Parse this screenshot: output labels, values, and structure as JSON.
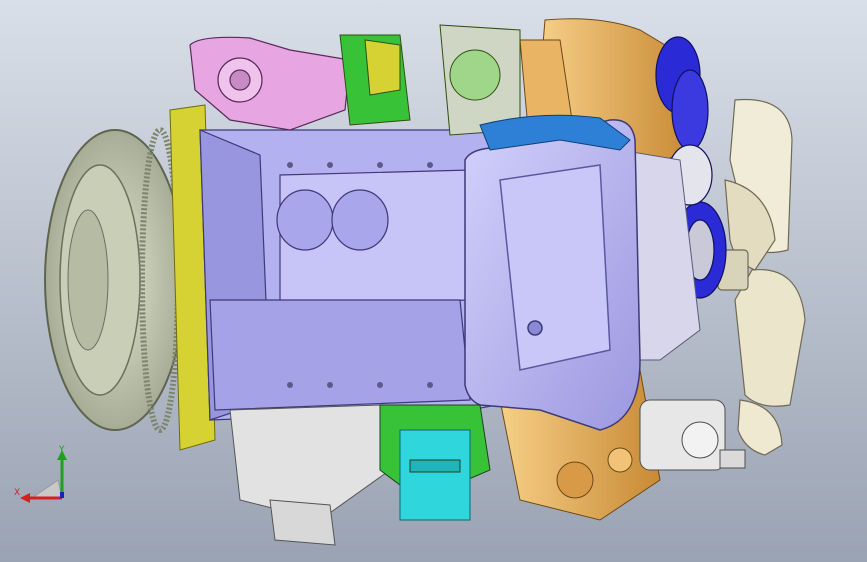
{
  "viewport": {
    "background_top": "#d9dfe8",
    "background_bottom": "#9aa3b3"
  },
  "model": {
    "subject": "engine-assembly-cad-model",
    "colors": {
      "block": "#b4b1f0",
      "block_dark": "#7d79c9",
      "oil_pan": "#c3c0f5",
      "flywheel": "#c9ceb6",
      "flywheel_ring": "#9aa089",
      "fan": "#f1ecd7",
      "alternator": "#e9b463",
      "manifold_pink": "#e7a5e2",
      "cooler_cyan": "#2fd6dc",
      "hose_blue": "#2e7fd6",
      "accent_green": "#37c237",
      "accent_yellow": "#d6d233",
      "pulley_blue": "#2a2ad6"
    }
  },
  "triad": {
    "x_label": "X",
    "y_label": "Y",
    "x_color": "#d42020",
    "y_color": "#1fa01f",
    "z_color": "#2020c0"
  }
}
